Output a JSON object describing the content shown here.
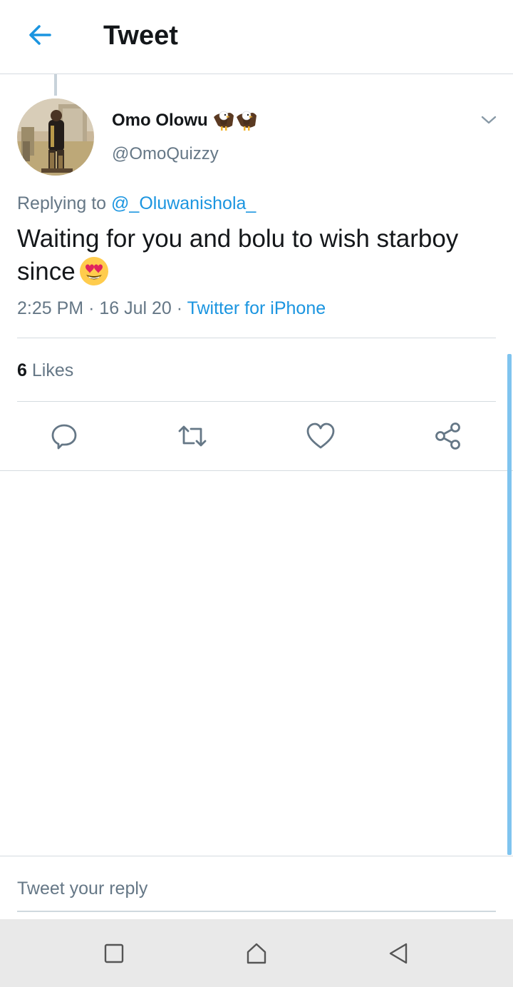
{
  "header": {
    "title": "Tweet",
    "back_icon": "arrow-left-icon"
  },
  "tweet": {
    "author": {
      "display_name": "Omo Olowu",
      "name_emoji": "eagle-emoji",
      "handle": "@OmoQuizzy"
    },
    "replying_prefix": "Replying to",
    "replying_to": "@_Oluwanishola_",
    "text": "Waiting for you and bolu to wish starboy since",
    "text_emoji": "heart-eyes-emoji",
    "time": "2:25 PM",
    "separator": "·",
    "date": "16 Jul 20",
    "source": "Twitter for iPhone",
    "likes_count": "6",
    "likes_label": "Likes"
  },
  "actions": [
    "reply-icon",
    "retweet-icon",
    "like-icon",
    "share-icon"
  ],
  "reply_box": {
    "placeholder": "Tweet your reply"
  },
  "system_nav": [
    "recents-icon",
    "home-icon",
    "back-icon"
  ],
  "colors": {
    "accent": "#1b95e0",
    "secondary_text": "#657786",
    "primary_text": "#14171a",
    "divider": "#d5dbe0",
    "nav_bar": "#e9e9e9"
  }
}
